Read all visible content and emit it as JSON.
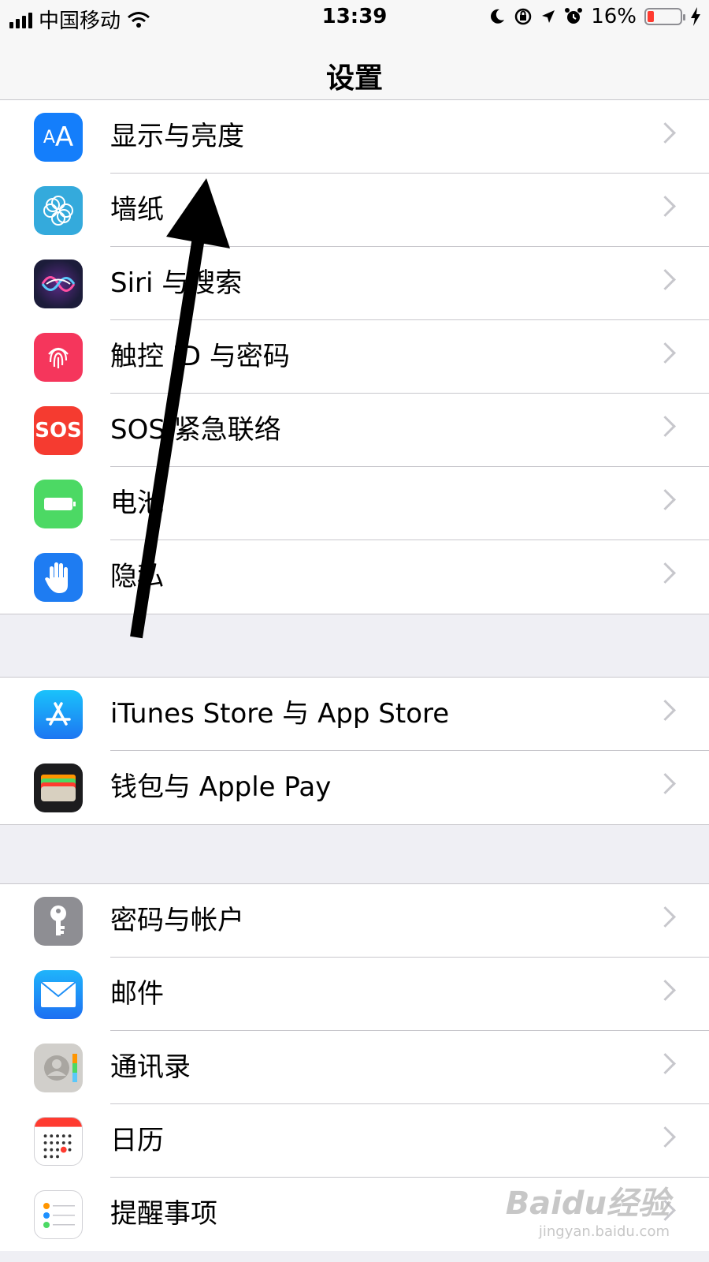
{
  "status_bar": {
    "carrier": "中国移动",
    "time": "13:39",
    "battery_text": "16%",
    "battery_level": 0.16,
    "icons": [
      "signal-icon",
      "wifi-icon",
      "moon-icon",
      "rotation-lock-icon",
      "location-icon",
      "alarm-icon",
      "battery-icon",
      "charging-icon"
    ]
  },
  "nav": {
    "title": "设置"
  },
  "groups": [
    {
      "items": [
        {
          "label": "显示与亮度",
          "icon": "display-brightness-icon",
          "color": "#147efb"
        },
        {
          "label": "墙纸",
          "icon": "wallpaper-icon",
          "color": "#34aadc"
        },
        {
          "label": "Siri 与搜索",
          "icon": "siri-icon",
          "color": "#1c1c3a"
        },
        {
          "label": "触控 ID 与密码",
          "icon": "touch-id-icon",
          "color": "#f5365c"
        },
        {
          "label": "SOS 紧急联络",
          "icon": "sos-icon",
          "color": "#f53b30",
          "icon_text": "SOS"
        },
        {
          "label": "电池",
          "icon": "battery-app-icon",
          "color": "#4cd964"
        },
        {
          "label": "隐私",
          "icon": "privacy-hand-icon",
          "color": "#1e7cf2"
        }
      ]
    },
    {
      "items": [
        {
          "label": "iTunes Store 与 App Store",
          "icon": "app-store-icon",
          "color": "#1e8cf8"
        },
        {
          "label": "钱包与 Apple Pay",
          "icon": "wallet-icon",
          "color": "#1c1c1e"
        }
      ]
    },
    {
      "items": [
        {
          "label": "密码与帐户",
          "icon": "key-icon",
          "color": "#8e8e93"
        },
        {
          "label": "邮件",
          "icon": "mail-icon",
          "color": "#1e90ff"
        },
        {
          "label": "通讯录",
          "icon": "contacts-icon",
          "color": "#bdbdbd"
        },
        {
          "label": "日历",
          "icon": "calendar-icon",
          "color": "#ffffff"
        },
        {
          "label": "提醒事项",
          "icon": "reminders-icon",
          "color": "#ffffff"
        }
      ]
    }
  ],
  "watermark": {
    "logo": "Baidu经验",
    "url": "jingyan.baidu.com"
  }
}
